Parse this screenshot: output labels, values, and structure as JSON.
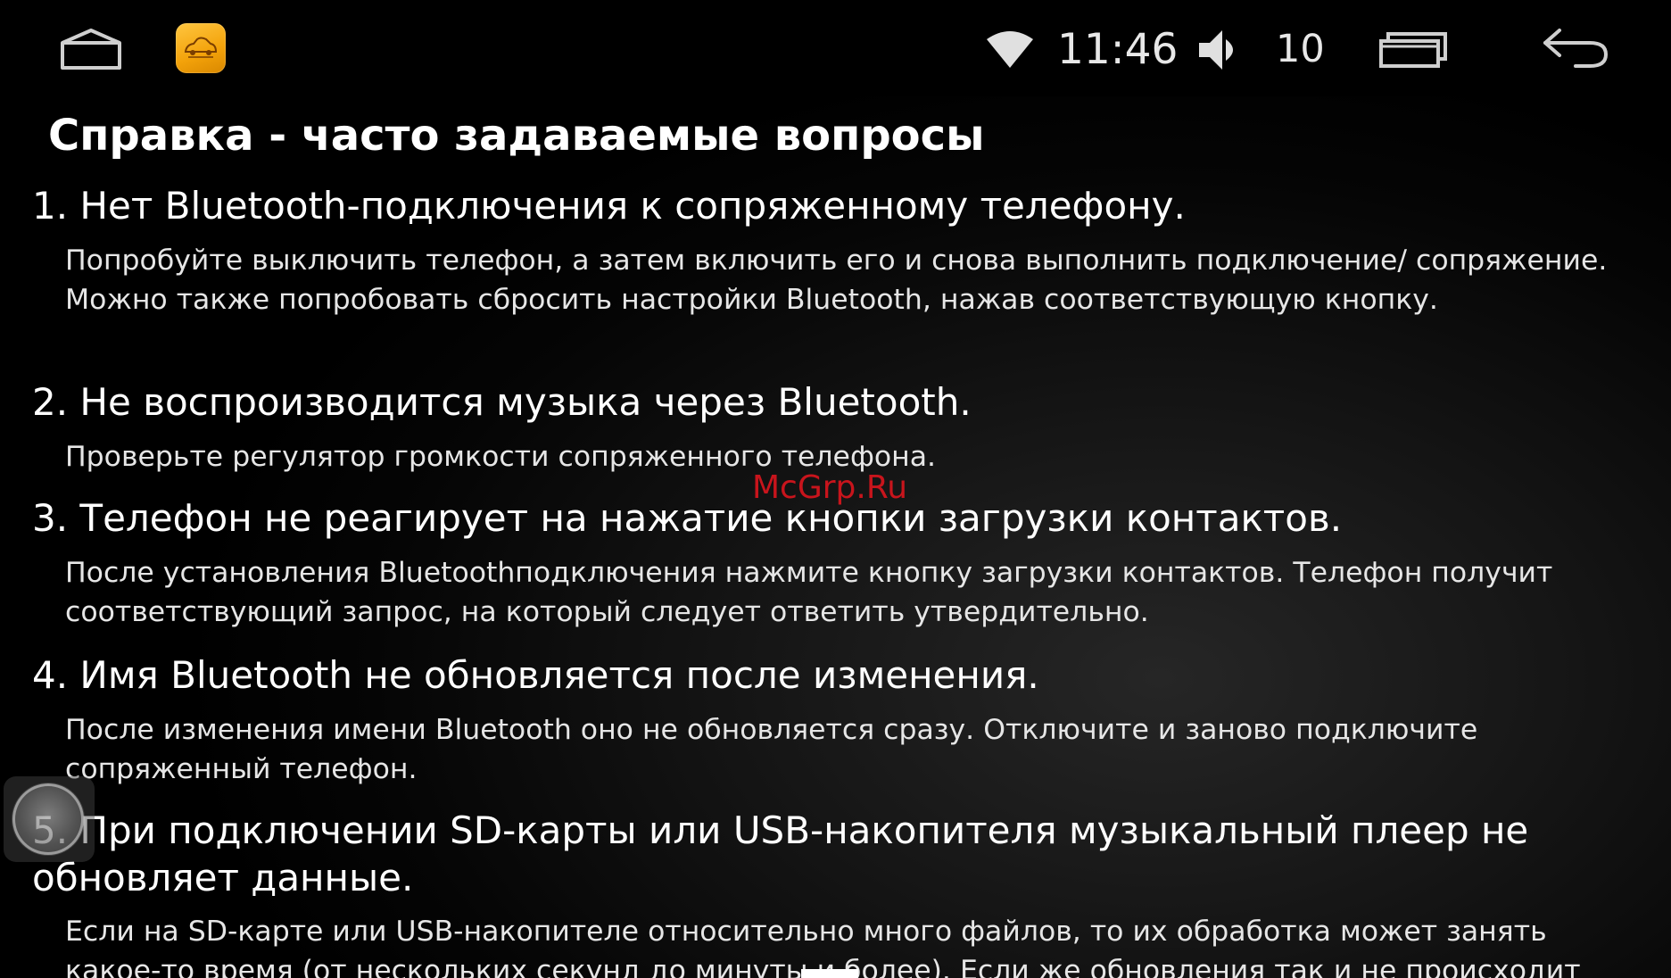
{
  "status_bar": {
    "home_icon": "home-outline-icon",
    "app_icon": "car-app-icon",
    "wifi_icon": "wifi-icon",
    "time": "11:46",
    "volume_icon": "speaker-icon",
    "volume_level": "10",
    "recent_apps_icon": "recent-apps-icon",
    "back_icon": "back-arrow-icon"
  },
  "page": {
    "title": "Справка - часто задаваемые вопросы",
    "faq": [
      {
        "question": "1. Нет Bluetooth-подключения к сопряженному телефону.",
        "answer": "Попробуйте выключить телефон, а затем включить его и снова выполнить подключение/ сопряжение. Можно также попробовать сбросить настройки Bluetooth, нажав соответствующую кнопку."
      },
      {
        "question": "2. Не воспроизводится музыка через Bluetooth.",
        "answer": "Проверьте регулятор громкости сопряженного телефона."
      },
      {
        "question": "3. Телефон не реагирует на нажатие кнопки загрузки контактов.",
        "answer": "После установления Bluetoothподключения нажмите кнопку загрузки контактов. Телефон получит соответствующий запрос, на который следует ответить утвердительно."
      },
      {
        "question": "4. Имя Bluetooth не обновляется после изменения.",
        "answer": "После изменения имени Bluetooth оно не обновляется сразу. Отключите и заново подключите сопряженный телефон."
      },
      {
        "question": "5. При подключении SD-карты или USB-накопителя музыкальный плеер не обновляет данные.",
        "answer": "Если на SD-карте или USB-накопителе относительно много файлов, то их обработка может занять какое-то время (от нескольких секунд до минуты и более). Если же обновления так и не происходит"
      }
    ]
  },
  "watermark": "McGrp.Ru",
  "colors": {
    "background": "#000000",
    "text": "#ffffff",
    "app_icon": "#f3a20a",
    "watermark": "#d8151d"
  }
}
